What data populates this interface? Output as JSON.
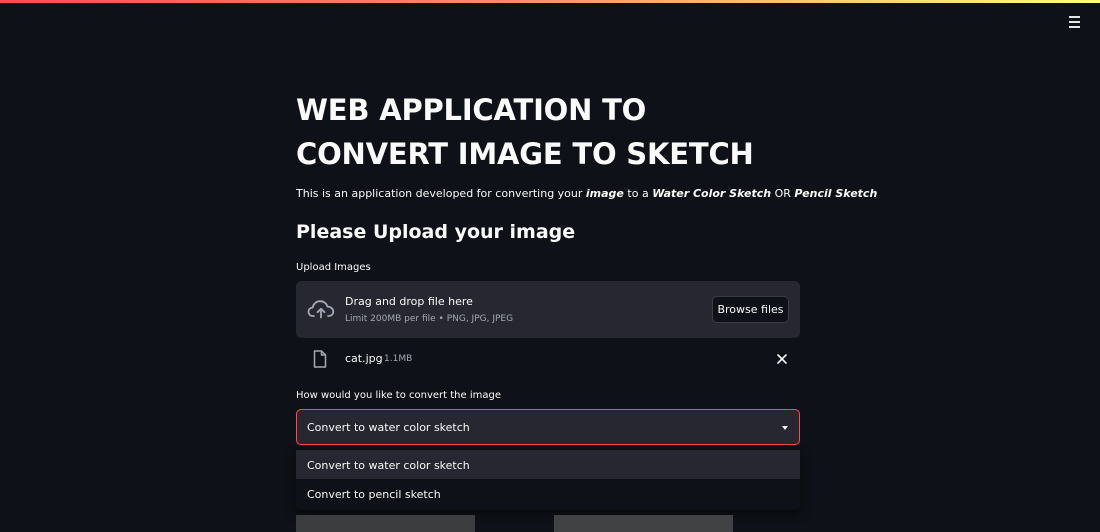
{
  "header": {
    "menu_icon": "hamburger-menu-icon"
  },
  "main": {
    "title": "WEB APPLICATION TO CONVERT IMAGE TO SKETCH",
    "intro": {
      "text_1": "This is an application developed for converting your ",
      "emph_1": "image",
      "text_2": " to a ",
      "emph_2": "Water Color Sketch",
      "text_3": " OR ",
      "emph_3": "Pencil Sketch"
    },
    "subheading": "Please Upload your image"
  },
  "uploader": {
    "label": "Upload Images",
    "drop_title": "Drag and drop file here",
    "drop_limit": "Limit 200MB per file • PNG, JPG, JPEG",
    "browse_label": "Browse files",
    "icon": "cloud-upload-icon",
    "file": {
      "name": "cat.jpg",
      "size": "1.1MB",
      "icon": "file-icon",
      "remove_icon": "close-icon"
    }
  },
  "converter": {
    "label": "How would you like to convert the image",
    "selected": "Convert to water color sketch",
    "options": [
      "Convert to water color sketch",
      "Convert to pencil sketch"
    ],
    "accent_color": "#ff4b4b"
  }
}
